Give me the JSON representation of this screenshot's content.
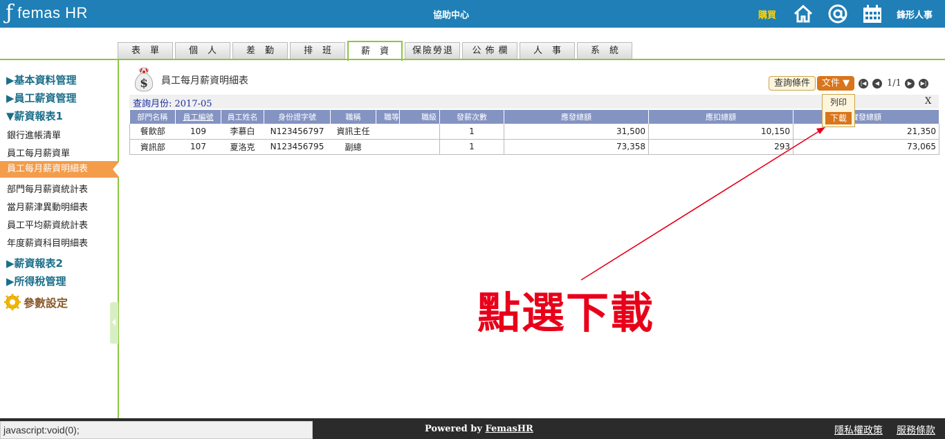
{
  "header": {
    "logo_text": "femas HR",
    "help_center": "協助中心",
    "buy": "購買",
    "brand": "鋒形人事"
  },
  "tabs": [
    {
      "label": "表單"
    },
    {
      "label": "個人"
    },
    {
      "label": "差勤"
    },
    {
      "label": "排班"
    },
    {
      "label": "薪資",
      "active": true
    },
    {
      "label": "保險勞退"
    },
    {
      "label": "公佈欄"
    },
    {
      "label": "人事"
    },
    {
      "label": "系統"
    }
  ],
  "sidebar": {
    "sections": [
      {
        "label": "▶基本資料管理"
      },
      {
        "label": "▶員工薪資管理"
      },
      {
        "label": "▼薪資報表1"
      }
    ],
    "items": [
      {
        "label": "銀行進帳清單"
      },
      {
        "label": "員工每月薪資單"
      },
      {
        "label": "員工每月薪資明細表",
        "active": true
      },
      {
        "label": "部門每月薪資統計表"
      },
      {
        "label": "當月薪津異動明細表"
      },
      {
        "label": "員工平均薪資統計表"
      },
      {
        "label": "年度薪資科目明細表"
      }
    ],
    "sections2": [
      {
        "label": "▶薪資報表2"
      },
      {
        "label": "▶所得稅管理"
      }
    ],
    "param_label": "參數設定"
  },
  "main": {
    "title": "員工每月薪資明細表",
    "query_button": "查詢條件",
    "doc_button": "文件",
    "pager_text": "1/1",
    "query_label": "查詢月份: 2017-05",
    "close": "X",
    "dropdown": {
      "print": "列印",
      "download": "下載"
    }
  },
  "table": {
    "headers": [
      "部門名稱",
      "員工編號",
      "員工姓名",
      "身份證字號",
      "職稱",
      "職等",
      "職級",
      "發薪次數",
      "應發總額",
      "應扣總額",
      "實發總額"
    ],
    "rows": [
      [
        "餐飲部",
        "109",
        "李慕白",
        "N123456797",
        "資訊主任",
        "",
        "",
        "1",
        "31,500",
        "10,150",
        "21,350"
      ],
      [
        "資訊部",
        "107",
        "夏洛克",
        "N123456795",
        "副總",
        "",
        "",
        "1",
        "73,358",
        "293",
        "73,065"
      ]
    ]
  },
  "annotation": "點選下載",
  "footer": {
    "status_url": "javascript:void(0);",
    "powered_prefix": "Powered by ",
    "powered_link": "FemasHR",
    "privacy": "隱私權政策",
    "terms": "服務條款"
  },
  "colors": {
    "topbar": "#1f7fb6",
    "accent_green": "#8cc63f",
    "active_orange": "#f39c4a",
    "table_header": "#8393c2",
    "annotation_red": "#e8001a"
  }
}
